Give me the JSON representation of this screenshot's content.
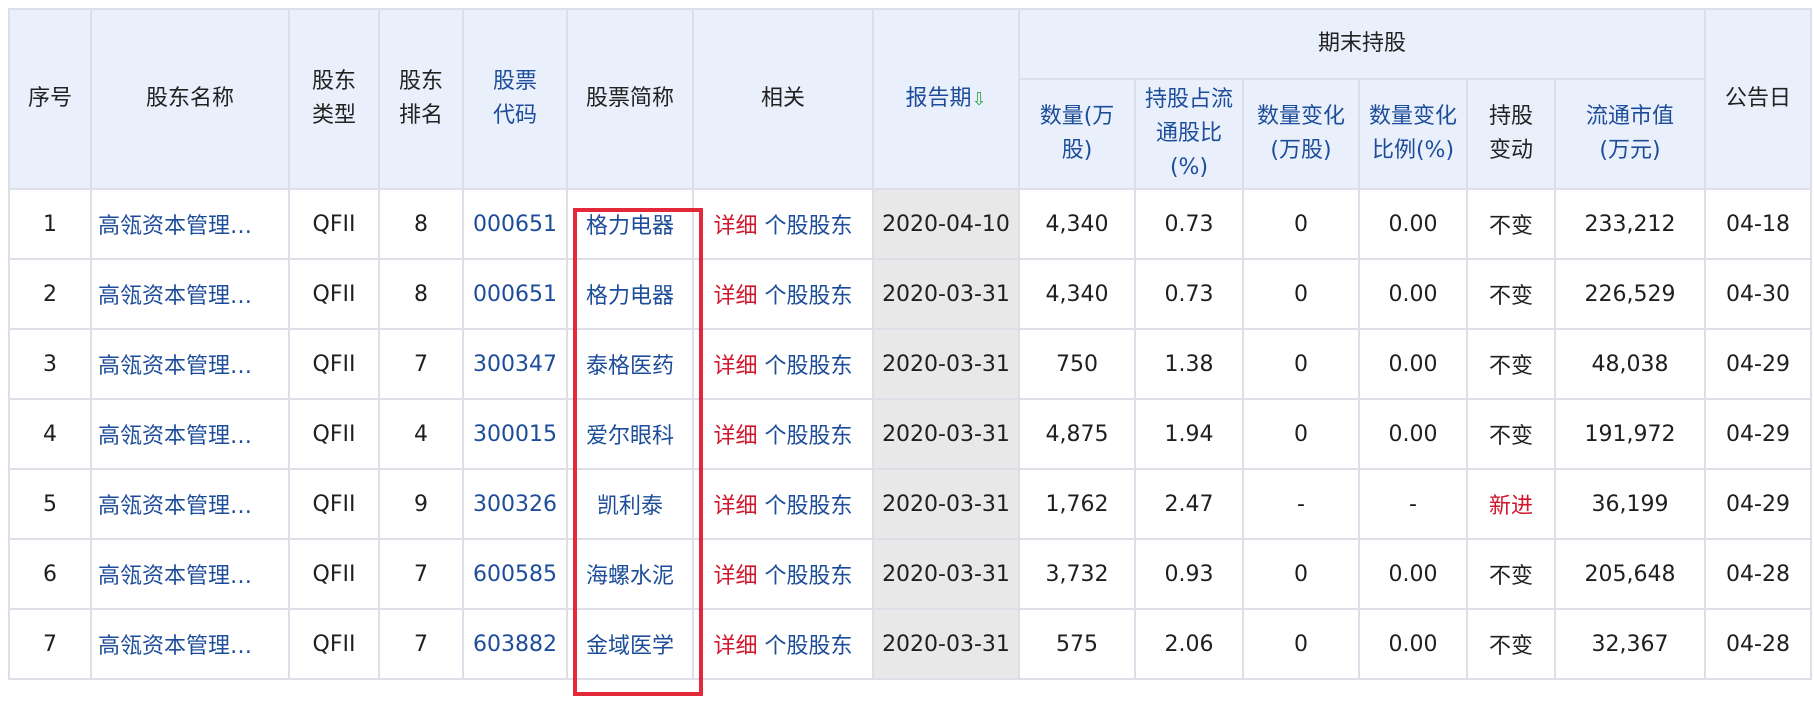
{
  "headers": {
    "seq": "序号",
    "holder_name": "股东名称",
    "holder_type": "股东类型",
    "holder_rank": "股东排名",
    "stock_code": "股票代码",
    "stock_name": "股票简称",
    "related": "相关",
    "report_period": "报告期",
    "group_end": "期末持股",
    "qty": "数量(万股)",
    "ratio": "持股占流通股比(%)",
    "qty_change": "数量变化(万股)",
    "qty_change_pct": "数量变化比例(%)",
    "hold_change": "持股变动",
    "market_value": "流通市值(万元)",
    "announce_date": "公告日"
  },
  "rows": [
    {
      "seq": "1",
      "holder": "高瓴资本管理…",
      "type": "QFII",
      "rank": "8",
      "code": "000651",
      "name": "格力电器",
      "detail": "详细",
      "stock_holders": "个股股东",
      "period": "2020-04-10",
      "qty": "4,340",
      "ratio": "0.73",
      "qchg": "0",
      "qchg_pct": "0.00",
      "change": "不变",
      "mv": "233,212",
      "ann": "04-18"
    },
    {
      "seq": "2",
      "holder": "高瓴资本管理…",
      "type": "QFII",
      "rank": "8",
      "code": "000651",
      "name": "格力电器",
      "detail": "详细",
      "stock_holders": "个股股东",
      "period": "2020-03-31",
      "qty": "4,340",
      "ratio": "0.73",
      "qchg": "0",
      "qchg_pct": "0.00",
      "change": "不变",
      "mv": "226,529",
      "ann": "04-30"
    },
    {
      "seq": "3",
      "holder": "高瓴资本管理…",
      "type": "QFII",
      "rank": "7",
      "code": "300347",
      "name": "泰格医药",
      "detail": "详细",
      "stock_holders": "个股股东",
      "period": "2020-03-31",
      "qty": "750",
      "ratio": "1.38",
      "qchg": "0",
      "qchg_pct": "0.00",
      "change": "不变",
      "mv": "48,038",
      "ann": "04-29"
    },
    {
      "seq": "4",
      "holder": "高瓴资本管理…",
      "type": "QFII",
      "rank": "4",
      "code": "300015",
      "name": "爱尔眼科",
      "detail": "详细",
      "stock_holders": "个股股东",
      "period": "2020-03-31",
      "qty": "4,875",
      "ratio": "1.94",
      "qchg": "0",
      "qchg_pct": "0.00",
      "change": "不变",
      "mv": "191,972",
      "ann": "04-29"
    },
    {
      "seq": "5",
      "holder": "高瓴资本管理…",
      "type": "QFII",
      "rank": "9",
      "code": "300326",
      "name": "凯利泰",
      "detail": "详细",
      "stock_holders": "个股股东",
      "period": "2020-03-31",
      "qty": "1,762",
      "ratio": "2.47",
      "qchg": "-",
      "qchg_pct": "-",
      "change": "新进",
      "mv": "36,199",
      "ann": "04-29"
    },
    {
      "seq": "6",
      "holder": "高瓴资本管理…",
      "type": "QFII",
      "rank": "7",
      "code": "600585",
      "name": "海螺水泥",
      "detail": "详细",
      "stock_holders": "个股股东",
      "period": "2020-03-31",
      "qty": "3,732",
      "ratio": "0.93",
      "qchg": "0",
      "qchg_pct": "0.00",
      "change": "不变",
      "mv": "205,648",
      "ann": "04-28"
    },
    {
      "seq": "7",
      "holder": "高瓴资本管理…",
      "type": "QFII",
      "rank": "7",
      "code": "603882",
      "name": "金域医学",
      "detail": "详细",
      "stock_holders": "个股股东",
      "period": "2020-03-31",
      "qty": "575",
      "ratio": "2.06",
      "qchg": "0",
      "qchg_pct": "0.00",
      "change": "不变",
      "mv": "32,367",
      "ann": "04-28"
    }
  ],
  "colors": {
    "header_bg": "#e9f0fb",
    "link": "#1d4d9a",
    "red": "#d0162b",
    "sorted_col_bg": "#e8e8e8",
    "highlight_box": "#e3283a"
  }
}
